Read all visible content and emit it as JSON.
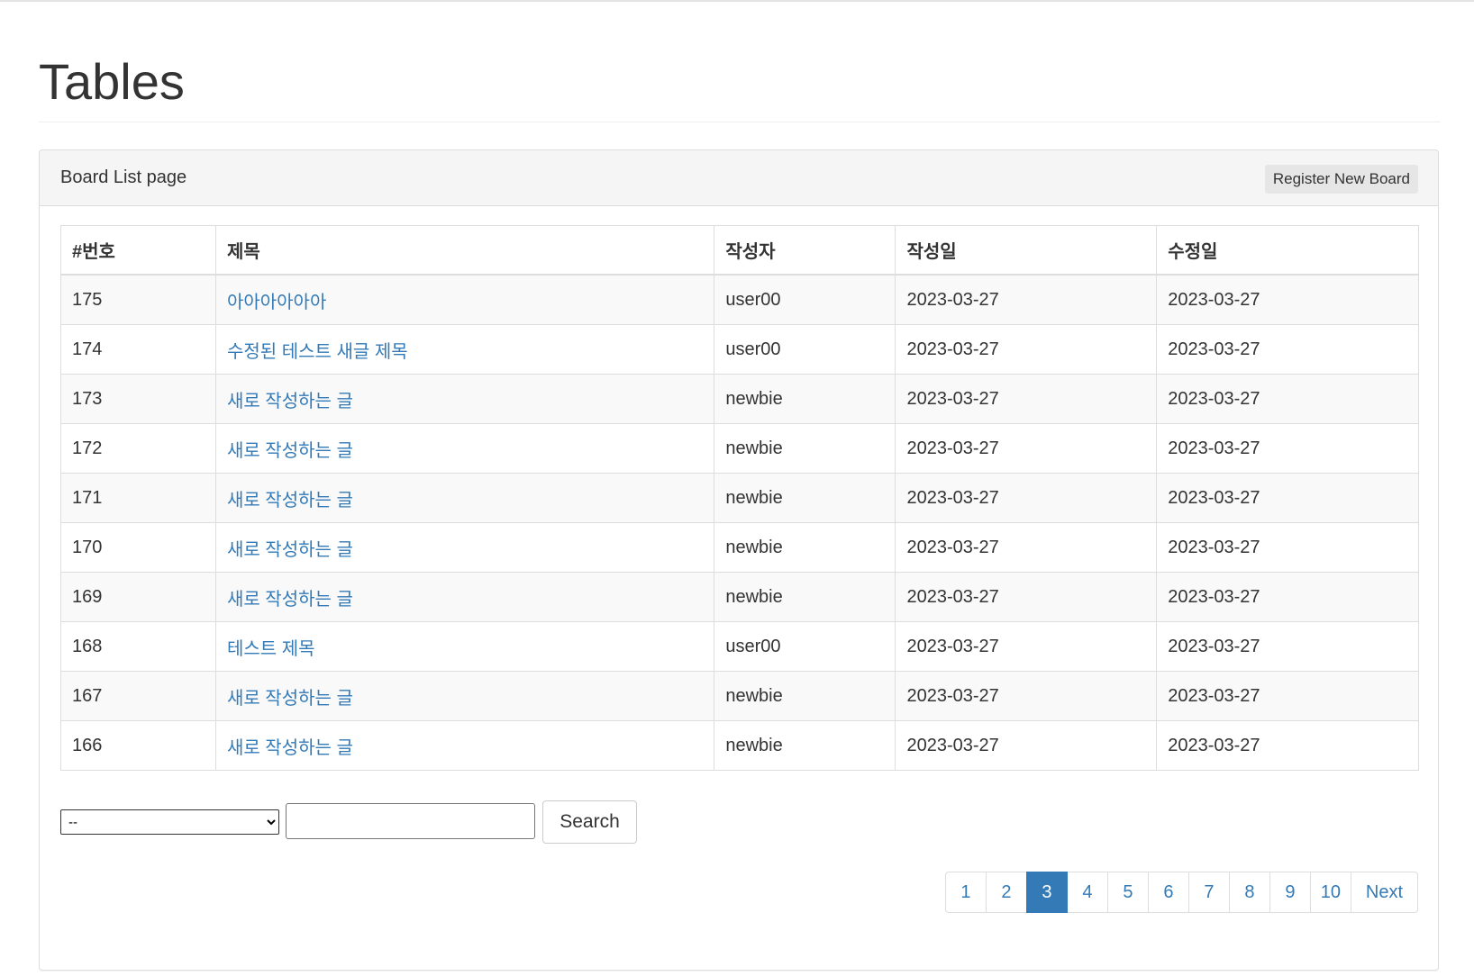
{
  "page": {
    "title": "Tables"
  },
  "panel": {
    "heading": "Board List page",
    "register_button": "Register New Board"
  },
  "table": {
    "columns": [
      "#번호",
      "제목",
      "작성자",
      "작성일",
      "수정일"
    ],
    "rows": [
      {
        "no": "175",
        "title": "아아아아아아",
        "writer": "user00",
        "regdate": "2023-03-27",
        "updatedate": "2023-03-27"
      },
      {
        "no": "174",
        "title": "수정된 테스트 새글 제목",
        "writer": "user00",
        "regdate": "2023-03-27",
        "updatedate": "2023-03-27"
      },
      {
        "no": "173",
        "title": "새로 작성하는 글",
        "writer": "newbie",
        "regdate": "2023-03-27",
        "updatedate": "2023-03-27"
      },
      {
        "no": "172",
        "title": "새로 작성하는 글",
        "writer": "newbie",
        "regdate": "2023-03-27",
        "updatedate": "2023-03-27"
      },
      {
        "no": "171",
        "title": "새로 작성하는 글",
        "writer": "newbie",
        "regdate": "2023-03-27",
        "updatedate": "2023-03-27"
      },
      {
        "no": "170",
        "title": "새로 작성하는 글",
        "writer": "newbie",
        "regdate": "2023-03-27",
        "updatedate": "2023-03-27"
      },
      {
        "no": "169",
        "title": "새로 작성하는 글",
        "writer": "newbie",
        "regdate": "2023-03-27",
        "updatedate": "2023-03-27"
      },
      {
        "no": "168",
        "title": "테스트 제목",
        "writer": "user00",
        "regdate": "2023-03-27",
        "updatedate": "2023-03-27"
      },
      {
        "no": "167",
        "title": "새로 작성하는 글",
        "writer": "newbie",
        "regdate": "2023-03-27",
        "updatedate": "2023-03-27"
      },
      {
        "no": "166",
        "title": "새로 작성하는 글",
        "writer": "newbie",
        "regdate": "2023-03-27",
        "updatedate": "2023-03-27"
      }
    ]
  },
  "search": {
    "type_selected": "--",
    "keyword_value": "",
    "button_label": "Search"
  },
  "pagination": {
    "pages": [
      "1",
      "2",
      "3",
      "4",
      "5",
      "6",
      "7",
      "8",
      "9",
      "10"
    ],
    "active_page": "3",
    "next_label": "Next"
  },
  "colors": {
    "link": "#337ab7",
    "active_page_bg": "#337ab7",
    "panel_heading_bg": "#f5f5f5",
    "striped_row_bg": "#f9f9f9"
  }
}
